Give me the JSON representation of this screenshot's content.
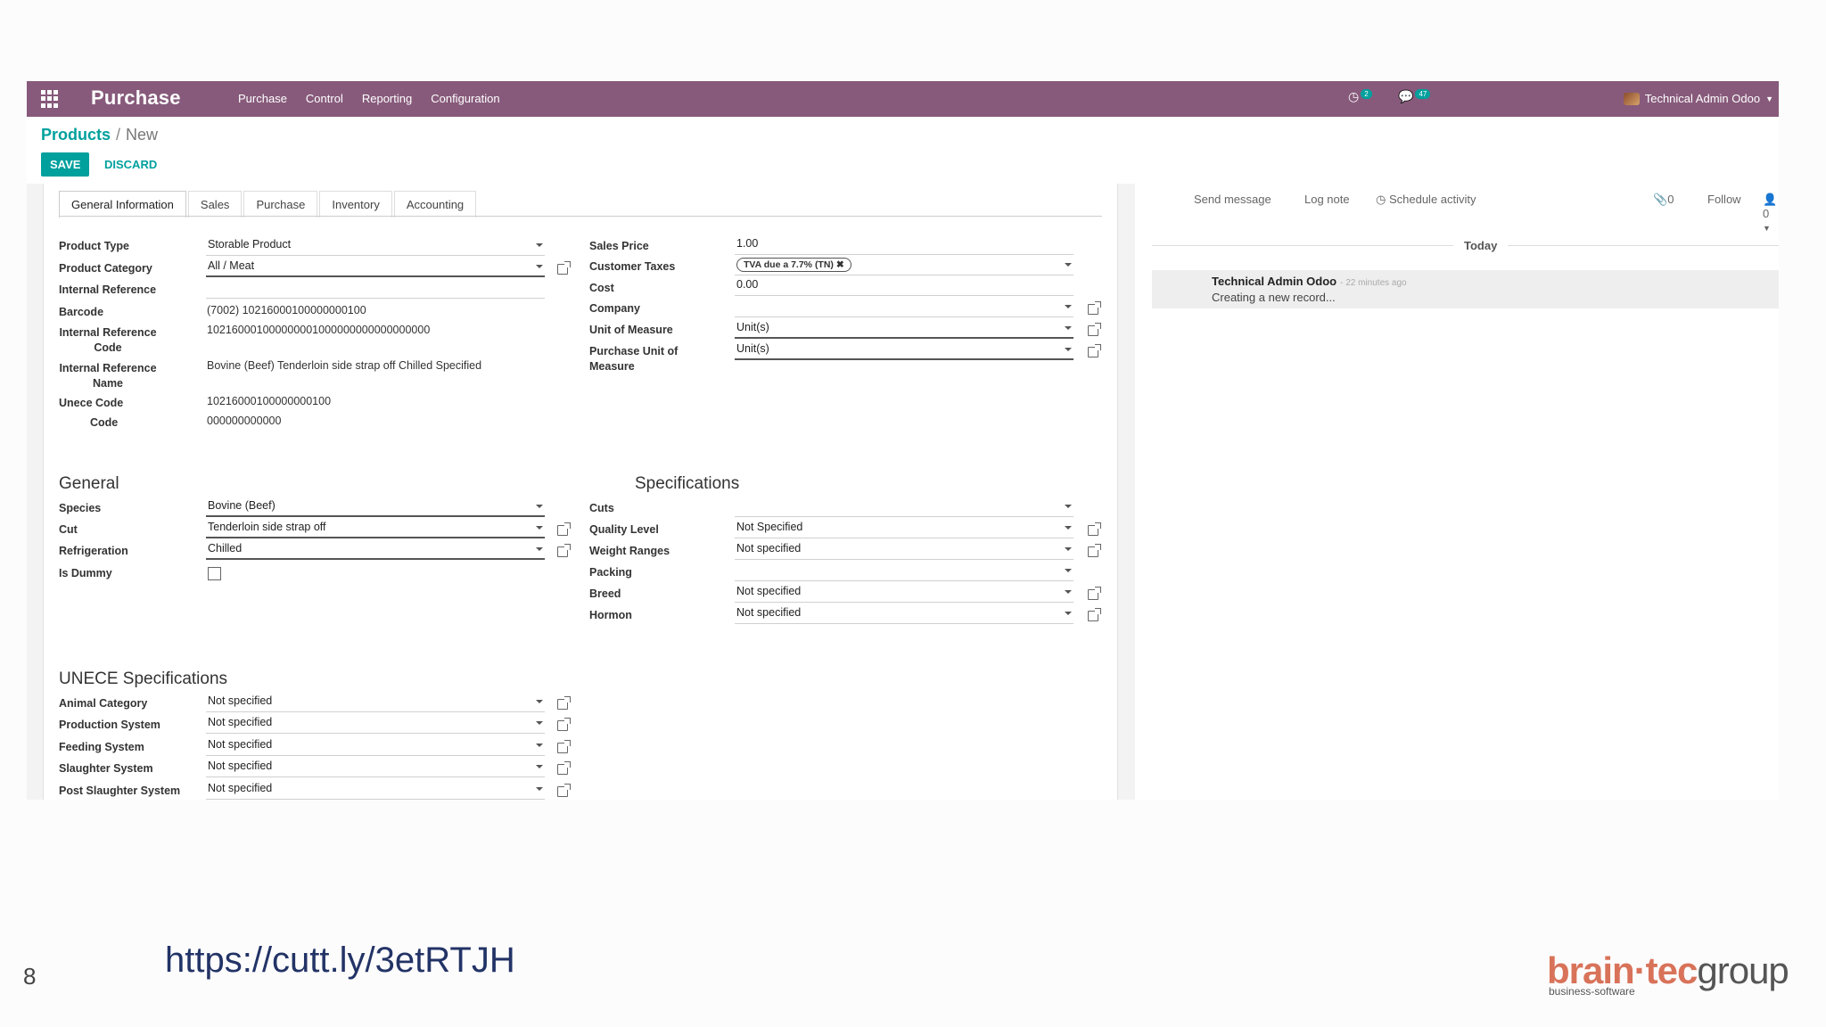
{
  "navbar": {
    "app_name": "Purchase",
    "menu": [
      "Purchase",
      "Control",
      "Reporting",
      "Configuration"
    ],
    "activity_count": "2",
    "message_count": "47",
    "user": "Technical Admin Odoo"
  },
  "breadcrumb": {
    "parent": "Products",
    "separator": "/",
    "current": "New"
  },
  "buttons": {
    "save": "SAVE",
    "discard": "DISCARD"
  },
  "tabs": [
    "General Information",
    "Sales",
    "Purchase",
    "Inventory",
    "Accounting"
  ],
  "left_fields": {
    "product_type": {
      "label": "Product Type",
      "value": "Storable Product"
    },
    "product_category": {
      "label": "Product Category",
      "value": "All / Meat"
    },
    "internal_reference": {
      "label": "Internal Reference",
      "value": ""
    },
    "barcode": {
      "label": "Barcode",
      "value": "(7002) 10216000100000000100"
    },
    "internal_reference_code": {
      "label": "Internal Reference Code",
      "value": "102160001000000001000000000000000000"
    },
    "internal_reference_name": {
      "label": "Internal Reference Name",
      "value": "Bovine (Beef) Tenderloin side strap off Chilled Specified"
    },
    "unece_code": {
      "label": "Unece Code",
      "value": "10216000100000000100"
    },
    "code": {
      "label": "Code",
      "value": "000000000000"
    }
  },
  "right_fields": {
    "sales_price": {
      "label": "Sales Price",
      "value": "1.00"
    },
    "customer_taxes": {
      "label": "Customer Taxes",
      "value": "TVA due a 7.7% (TN)"
    },
    "cost": {
      "label": "Cost",
      "value": "0.00"
    },
    "company": {
      "label": "Company",
      "value": ""
    },
    "uom": {
      "label": "Unit of Measure",
      "value": "Unit(s)"
    },
    "purchase_uom": {
      "label": "Purchase Unit of Measure",
      "value": "Unit(s)"
    }
  },
  "general": {
    "title": "General",
    "species": {
      "label": "Species",
      "value": "Bovine (Beef)"
    },
    "cut": {
      "label": "Cut",
      "value": "Tenderloin side strap off"
    },
    "refrigeration": {
      "label": "Refrigeration",
      "value": "Chilled"
    },
    "is_dummy": {
      "label": "Is Dummy",
      "checked": false
    }
  },
  "specifications": {
    "title": "Specifications",
    "cuts": {
      "label": "Cuts",
      "value": ""
    },
    "quality_level": {
      "label": "Quality Level",
      "value": "Not Specified"
    },
    "weight_ranges": {
      "label": "Weight Ranges",
      "value": "Not specified"
    },
    "packing": {
      "label": "Packing",
      "value": ""
    },
    "breed": {
      "label": "Breed",
      "value": "Not specified"
    },
    "hormon": {
      "label": "Hormon",
      "value": "Not specified"
    }
  },
  "unece": {
    "title": "UNECE Specifications",
    "rows": [
      {
        "label": "Animal Category",
        "value": "Not specified"
      },
      {
        "label": "Production System",
        "value": "Not specified"
      },
      {
        "label": "Feeding System",
        "value": "Not specified"
      },
      {
        "label": "Slaughter System",
        "value": "Not specified"
      },
      {
        "label": "Post Slaughter System",
        "value": "Not specified"
      }
    ]
  },
  "chatter": {
    "send_message": "Send message",
    "log_note": "Log note",
    "schedule_activity": "Schedule activity",
    "attachments": "0",
    "follow": "Follow",
    "followers": "0",
    "today": "Today",
    "message": {
      "author": "Technical Admin Odoo",
      "ago": "- 22 minutes ago",
      "text": "Creating a new record..."
    }
  },
  "slide": {
    "page_number": "8",
    "url": "https://cutt.ly/3etRTJH",
    "logo_brain": "brain·tec",
    "logo_group": "group",
    "logo_sub": "business-software"
  },
  "colors": {
    "navbar": "#875a7b",
    "accent": "#00a09d"
  }
}
